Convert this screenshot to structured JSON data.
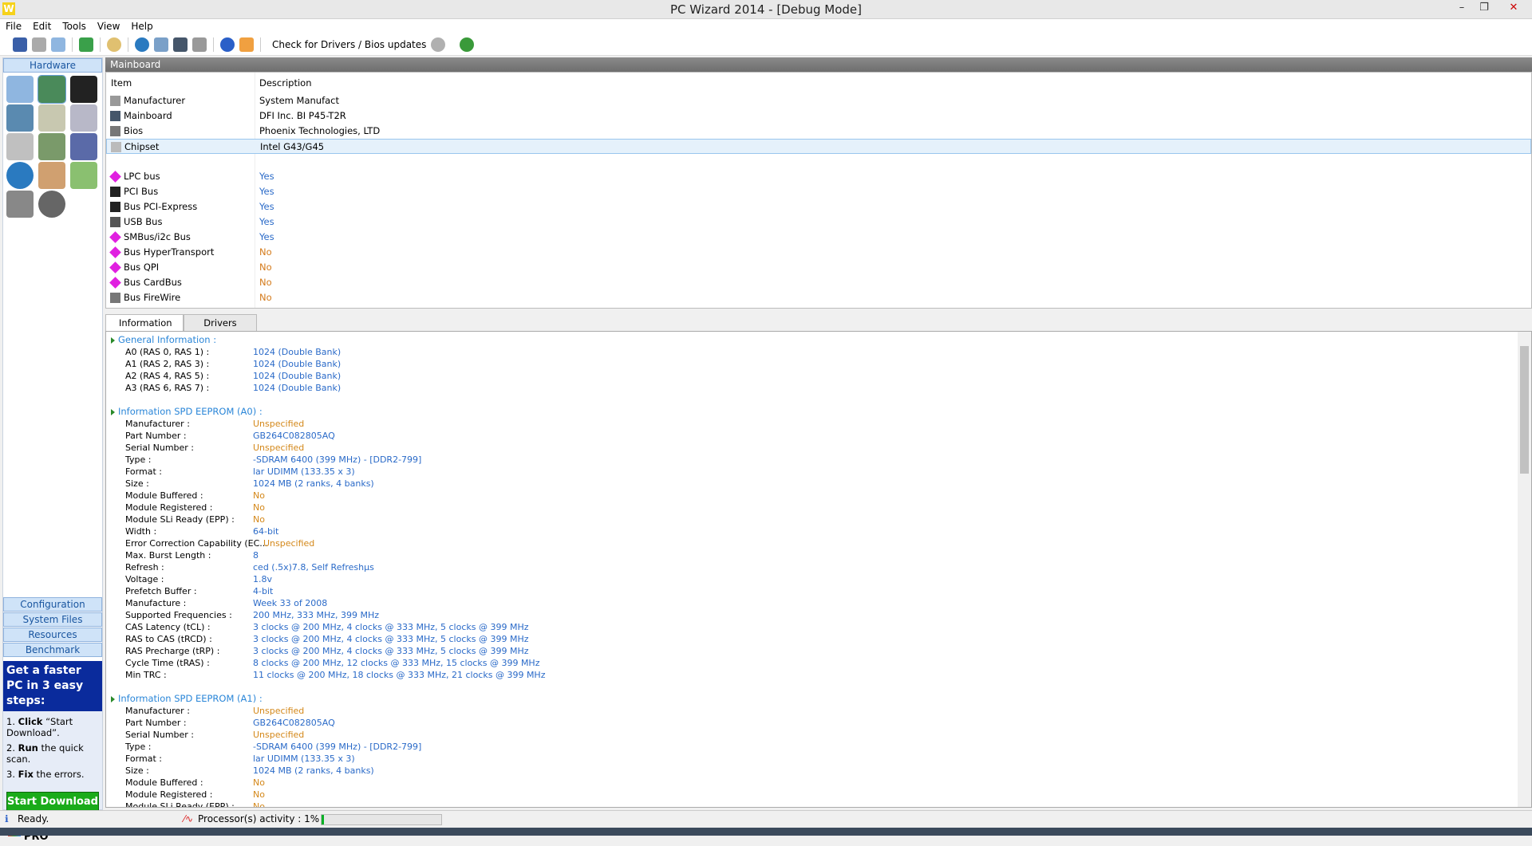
{
  "window": {
    "title": "PC Wizard 2014 - [Debug Mode]",
    "app_letter": "W"
  },
  "menu": [
    "File",
    "Edit",
    "Tools",
    "View",
    "Help"
  ],
  "toolbar": {
    "check_updates": "Check for Drivers / Bios updates"
  },
  "sidebar": {
    "hardware": "Hardware",
    "nav": [
      "Configuration",
      "System Files",
      "Resources",
      "Benchmark"
    ],
    "ad": {
      "headline": "Get a faster PC in 3 easy steps:",
      "steps": [
        {
          "b": "Click",
          "t": " “Start Download”."
        },
        {
          "b": "Run",
          "t": " the quick scan."
        },
        {
          "b": "Fix",
          "t": "  the errors."
        }
      ],
      "button": "Start Download",
      "product": "RegClean PRO"
    }
  },
  "panel": {
    "title": "Mainboard",
    "col_item": "Item",
    "col_desc": "Description",
    "rows": [
      {
        "item": "Manufacturer",
        "desc": "System Manufact"
      },
      {
        "item": "Mainboard",
        "desc": "DFI Inc. BI P45-T2R"
      },
      {
        "item": "Bios",
        "desc": "Phoenix Technologies, LTD"
      },
      {
        "item": "Chipset",
        "desc": "Intel G43/G45"
      }
    ],
    "buses": [
      {
        "item": "LPC bus",
        "desc": "Yes"
      },
      {
        "item": "PCI Bus",
        "desc": "Yes"
      },
      {
        "item": "Bus PCI-Express",
        "desc": "Yes"
      },
      {
        "item": "USB Bus",
        "desc": "Yes"
      },
      {
        "item": "SMBus/i2c Bus",
        "desc": "Yes"
      },
      {
        "item": "Bus HyperTransport",
        "desc": "No"
      },
      {
        "item": "Bus QPI",
        "desc": "No"
      },
      {
        "item": "Bus CardBus",
        "desc": "No"
      },
      {
        "item": "Bus FireWire",
        "desc": "No"
      }
    ]
  },
  "tabs": [
    "Information",
    "Drivers"
  ],
  "info": [
    {
      "section": "General Information :"
    },
    {
      "k": "A0 (RAS 0, RAS 1) :",
      "v": "1024 (Double Bank)",
      "c": "b"
    },
    {
      "k": "A1 (RAS 2, RAS 3) :",
      "v": "1024 (Double Bank)",
      "c": "b"
    },
    {
      "k": "A2 (RAS 4, RAS 5) :",
      "v": "1024 (Double Bank)",
      "c": "b"
    },
    {
      "k": "A3 (RAS 6, RAS 7) :",
      "v": "1024 (Double Bank)",
      "c": "b"
    },
    {
      "blank": true
    },
    {
      "section": "Information SPD EEPROM (A0) :"
    },
    {
      "k": "Manufacturer :",
      "v": "Unspecified",
      "c": "o"
    },
    {
      "k": "Part Number :",
      "v": "GB264C082805AQ",
      "c": "b"
    },
    {
      "k": "Serial Number :",
      "v": "Unspecified",
      "c": "o"
    },
    {
      "k": "Type :",
      "v": "-SDRAM 6400 (399 MHz)  -  [DDR2-799]",
      "c": "b"
    },
    {
      "k": "Format :",
      "v": "lar UDIMM (133.35 x 3)",
      "c": "b"
    },
    {
      "k": "Size :",
      "v": "1024  MB (2 ranks, 4 banks)",
      "c": "b"
    },
    {
      "k": "Module Buffered :",
      "v": "No",
      "c": "o"
    },
    {
      "k": "Module Registered :",
      "v": "No",
      "c": "o"
    },
    {
      "k": "Module SLi Ready (EPP) :",
      "v": "No",
      "c": "o"
    },
    {
      "k": "Width :",
      "v": "64-bit",
      "c": "b"
    },
    {
      "k": "Error Correction Capability (EC...",
      "v": "Unspecified",
      "c": "o",
      "shift": true
    },
    {
      "k": "Max. Burst Length :",
      "v": "8",
      "c": "b"
    },
    {
      "k": "Refresh :",
      "v": "ced (.5x)7.8, Self Refreshµs",
      "c": "b"
    },
    {
      "k": "Voltage :",
      "v": "1.8v",
      "c": "b"
    },
    {
      "k": "Prefetch Buffer :",
      "v": "4-bit",
      "c": "b"
    },
    {
      "k": "Manufacture :",
      "v": "Week 33 of 2008",
      "c": "b"
    },
    {
      "k": "Supported Frequencies :",
      "v": "200 MHz, 333 MHz, 399 MHz",
      "c": "b"
    },
    {
      "k": "CAS Latency (tCL) :",
      "v": "3 clocks @ 200 MHz, 4 clocks @ 333 MHz, 5 clocks @ 399 MHz",
      "c": "b"
    },
    {
      "k": "RAS to CAS (tRCD) :",
      "v": "3 clocks @ 200 MHz, 4 clocks @ 333 MHz, 5 clocks @ 399 MHz",
      "c": "b"
    },
    {
      "k": "RAS Precharge (tRP) :",
      "v": "3 clocks @ 200 MHz, 4 clocks @ 333 MHz, 5 clocks @ 399 MHz",
      "c": "b"
    },
    {
      "k": "Cycle Time (tRAS) :",
      "v": "8 clocks @ 200 MHz, 12 clocks @ 333 MHz, 15 clocks @ 399 MHz",
      "c": "b"
    },
    {
      "k": "Min TRC :",
      "v": "11 clocks @ 200 MHz, 18 clocks @ 333 MHz, 21 clocks @ 399 MHz",
      "c": "b"
    },
    {
      "blank": true
    },
    {
      "section": "Information SPD EEPROM (A1) :"
    },
    {
      "k": "Manufacturer :",
      "v": "Unspecified",
      "c": "o"
    },
    {
      "k": "Part Number :",
      "v": "GB264C082805AQ",
      "c": "b"
    },
    {
      "k": "Serial Number :",
      "v": "Unspecified",
      "c": "o"
    },
    {
      "k": "Type :",
      "v": "-SDRAM 6400 (399 MHz)  -  [DDR2-799]",
      "c": "b"
    },
    {
      "k": "Format :",
      "v": "lar UDIMM (133.35 x 3)",
      "c": "b"
    },
    {
      "k": "Size :",
      "v": "1024  MB (2 ranks, 4 banks)",
      "c": "b"
    },
    {
      "k": "Module Buffered :",
      "v": "No",
      "c": "o"
    },
    {
      "k": "Module Registered :",
      "v": "No",
      "c": "o"
    },
    {
      "k": "Module SLi Ready (EPP) :",
      "v": "No",
      "c": "o"
    }
  ],
  "status": {
    "ready": "Ready.",
    "activity": "Processor(s) activity : 1%",
    "activity_percent": 1
  }
}
